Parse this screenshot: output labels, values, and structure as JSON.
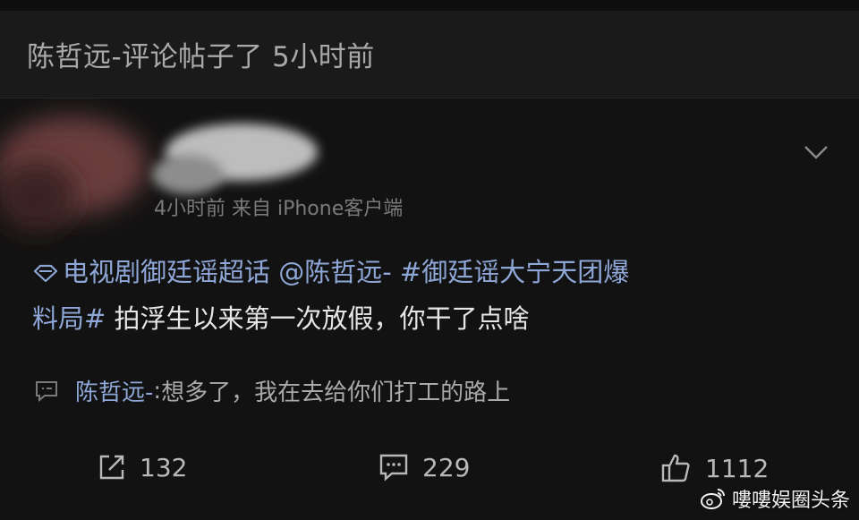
{
  "header": {
    "title": "陈哲远-评论帖子了 5小时前"
  },
  "post": {
    "meta": "4小时前  来自 iPhone客户端",
    "topic_tag": "电视剧御廷谣超话",
    "mention": "@陈哲远-",
    "hashtag_part1": "#御廷谣大宁天团爆",
    "hashtag_part2": "料局#",
    "content": "拍浮生以来第一次放假，你干了点啥"
  },
  "reply": {
    "user": "陈哲远-",
    "separator": ": ",
    "text": "想多了，我在去给你们打工的路上"
  },
  "actions": {
    "repost_count": "132",
    "comment_count": "229",
    "like_count": "1112"
  },
  "watermark": {
    "text": "嘍嘍娱圈头条"
  },
  "colors": {
    "background": "#121212",
    "header_bg": "#1a1a1a",
    "link": "#8ea7d7",
    "text": "#e6e6e6",
    "muted": "#7a7a7a"
  }
}
